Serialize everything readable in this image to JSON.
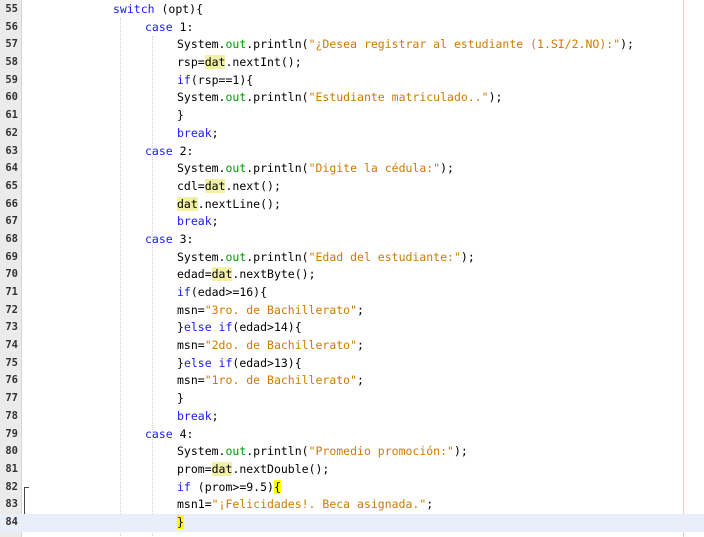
{
  "editor": {
    "lines": [
      {
        "n": "55",
        "indent": 0,
        "tokens": [
          [
            "kw",
            "switch"
          ],
          [
            "plain",
            " (opt){"
          ]
        ]
      },
      {
        "n": "56",
        "indent": 1,
        "tokens": [
          [
            "kw",
            "case"
          ],
          [
            "plain",
            " 1:"
          ]
        ]
      },
      {
        "n": "57",
        "indent": 2,
        "tokens": [
          [
            "plain",
            "System."
          ],
          [
            "field",
            "out"
          ],
          [
            "plain",
            ".println("
          ],
          [
            "str",
            "\"¿Desea registrar al estudiante (1.SI/2.NO):\""
          ],
          [
            "plain",
            ");"
          ]
        ]
      },
      {
        "n": "58",
        "indent": 2,
        "tokens": [
          [
            "plain",
            "rsp="
          ],
          [
            "hl",
            "dat"
          ],
          [
            "plain",
            ".nextInt();"
          ]
        ]
      },
      {
        "n": "59",
        "indent": 2,
        "tokens": [
          [
            "kw",
            "if"
          ],
          [
            "plain",
            "(rsp==1){"
          ]
        ]
      },
      {
        "n": "60",
        "indent": 2,
        "tokens": [
          [
            "plain",
            "System."
          ],
          [
            "field",
            "out"
          ],
          [
            "plain",
            ".println("
          ],
          [
            "str",
            "\"Estudiante matriculado..\""
          ],
          [
            "plain",
            ");"
          ]
        ]
      },
      {
        "n": "61",
        "indent": 2,
        "tokens": [
          [
            "plain",
            "}"
          ]
        ]
      },
      {
        "n": "62",
        "indent": 2,
        "tokens": [
          [
            "kw",
            "break"
          ],
          [
            "plain",
            ";"
          ]
        ]
      },
      {
        "n": "63",
        "indent": 1,
        "tokens": [
          [
            "kw",
            "case"
          ],
          [
            "plain",
            " 2:"
          ]
        ]
      },
      {
        "n": "64",
        "indent": 2,
        "tokens": [
          [
            "plain",
            "System."
          ],
          [
            "field",
            "out"
          ],
          [
            "plain",
            ".println("
          ],
          [
            "str",
            "\"Digite la cédula:\""
          ],
          [
            "plain",
            ");"
          ]
        ]
      },
      {
        "n": "65",
        "indent": 2,
        "tokens": [
          [
            "plain",
            "cdl="
          ],
          [
            "hl",
            "dat"
          ],
          [
            "plain",
            ".next();"
          ]
        ]
      },
      {
        "n": "66",
        "indent": 2,
        "tokens": [
          [
            "hl",
            "dat"
          ],
          [
            "plain",
            ".nextLine();"
          ]
        ]
      },
      {
        "n": "67",
        "indent": 2,
        "tokens": [
          [
            "kw",
            "break"
          ],
          [
            "plain",
            ";"
          ]
        ]
      },
      {
        "n": "68",
        "indent": 1,
        "tokens": [
          [
            "kw",
            "case"
          ],
          [
            "plain",
            " 3:"
          ]
        ]
      },
      {
        "n": "69",
        "indent": 2,
        "tokens": [
          [
            "plain",
            "System."
          ],
          [
            "field",
            "out"
          ],
          [
            "plain",
            ".println("
          ],
          [
            "str",
            "\"Edad del estudiante:\""
          ],
          [
            "plain",
            ");"
          ]
        ]
      },
      {
        "n": "70",
        "indent": 2,
        "tokens": [
          [
            "plain",
            "edad="
          ],
          [
            "hl",
            "dat"
          ],
          [
            "plain",
            ".nextByte();"
          ]
        ]
      },
      {
        "n": "71",
        "indent": 2,
        "tokens": [
          [
            "kw",
            "if"
          ],
          [
            "plain",
            "(edad>=16){"
          ]
        ]
      },
      {
        "n": "72",
        "indent": 2,
        "tokens": [
          [
            "plain",
            "msn="
          ],
          [
            "str",
            "\"3ro. de Bachillerato\""
          ],
          [
            "plain",
            ";"
          ]
        ]
      },
      {
        "n": "73",
        "indent": 2,
        "tokens": [
          [
            "plain",
            "}"
          ],
          [
            "kw",
            "else if"
          ],
          [
            "plain",
            "(edad>14){"
          ]
        ]
      },
      {
        "n": "74",
        "indent": 2,
        "tokens": [
          [
            "plain",
            "msn="
          ],
          [
            "str",
            "\"2do. de Bachillerato\""
          ],
          [
            "plain",
            ";"
          ]
        ]
      },
      {
        "n": "75",
        "indent": 2,
        "tokens": [
          [
            "plain",
            "}"
          ],
          [
            "kw",
            "else if"
          ],
          [
            "plain",
            "(edad>13){"
          ]
        ]
      },
      {
        "n": "76",
        "indent": 2,
        "tokens": [
          [
            "plain",
            "msn="
          ],
          [
            "str",
            "\"1ro. de Bachillerato\""
          ],
          [
            "plain",
            ";"
          ]
        ]
      },
      {
        "n": "77",
        "indent": 2,
        "tokens": [
          [
            "plain",
            "}"
          ]
        ]
      },
      {
        "n": "78",
        "indent": 2,
        "tokens": [
          [
            "kw",
            "break"
          ],
          [
            "plain",
            ";"
          ]
        ]
      },
      {
        "n": "79",
        "indent": 1,
        "tokens": [
          [
            "kw",
            "case"
          ],
          [
            "plain",
            " 4:"
          ]
        ]
      },
      {
        "n": "80",
        "indent": 2,
        "tokens": [
          [
            "plain",
            "System."
          ],
          [
            "field",
            "out"
          ],
          [
            "plain",
            ".println("
          ],
          [
            "str",
            "\"Promedio promoción:\""
          ],
          [
            "plain",
            ");"
          ]
        ]
      },
      {
        "n": "81",
        "indent": 2,
        "tokens": [
          [
            "plain",
            "prom="
          ],
          [
            "hl",
            "dat"
          ],
          [
            "plain",
            ".nextDouble();"
          ]
        ]
      },
      {
        "n": "82",
        "indent": 2,
        "tokens": [
          [
            "kw",
            "if"
          ],
          [
            "plain",
            " (prom>=9.5)"
          ],
          [
            "brace",
            "{"
          ]
        ]
      },
      {
        "n": "83",
        "indent": 2,
        "tokens": [
          [
            "plain",
            "msn1="
          ],
          [
            "str",
            "\"¡Felicidades!. Beca asignada.\""
          ],
          [
            "plain",
            ";"
          ]
        ]
      },
      {
        "n": "84",
        "indent": 2,
        "current": true,
        "tokens": [
          [
            "brace",
            "}"
          ]
        ]
      }
    ]
  }
}
